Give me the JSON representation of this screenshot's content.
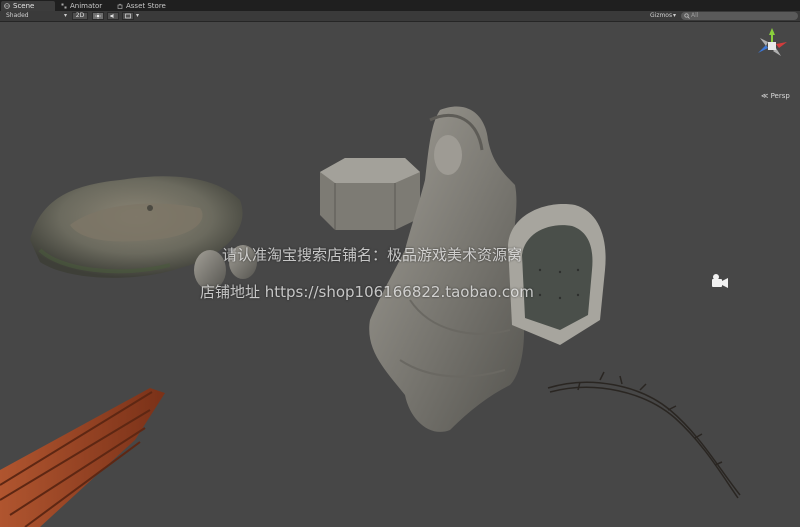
{
  "tabs": [
    {
      "label": "Scene",
      "icon": "scene-icon"
    },
    {
      "label": "Animator",
      "icon": "animator-icon"
    },
    {
      "label": "Asset Store",
      "icon": "asset-store-icon"
    }
  ],
  "toolbar": {
    "render_mode": "Shaded",
    "mode_2d": "2D",
    "gizmos": "Gizmos",
    "search_placeholder": "All"
  },
  "gizmo": {
    "projection": "Persp"
  },
  "watermark": {
    "line1": "请认准淘宝搜索店铺名：极品游戏美术资源窝",
    "line2": "店铺地址 https://shop106166822.taobao.com"
  },
  "colors": {
    "background": "#474747",
    "gizmo_x": "#d23c3c",
    "gizmo_y": "#8ad03c",
    "gizmo_z": "#3c78d8"
  }
}
